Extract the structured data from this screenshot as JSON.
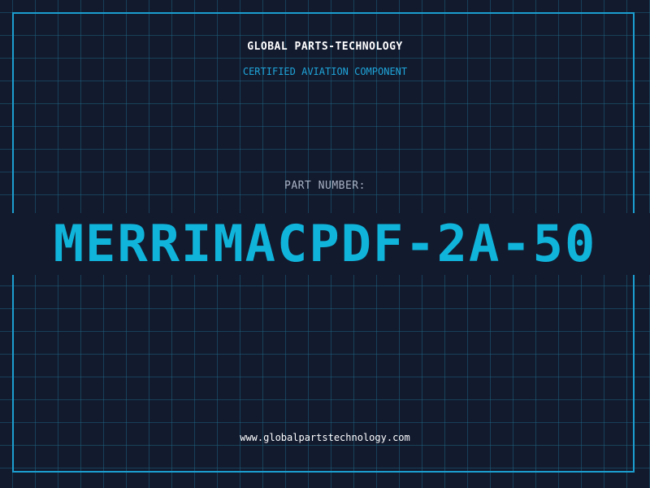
{
  "header": {
    "company": "GLOBAL PARTS-TECHNOLOGY",
    "tagline": "CERTIFIED AVIATION COMPONENT"
  },
  "part": {
    "label": "PART NUMBER:",
    "number": "MERRIMACPDF-2A-50"
  },
  "footer": {
    "website": "www.globalpartstechnology.com"
  },
  "colors": {
    "background": "#121a2e",
    "grid": "#1e5f7a",
    "frame": "#1b9ecf",
    "accent": "#10b4db",
    "label": "#a8b3c4",
    "text": "#ffffff"
  }
}
